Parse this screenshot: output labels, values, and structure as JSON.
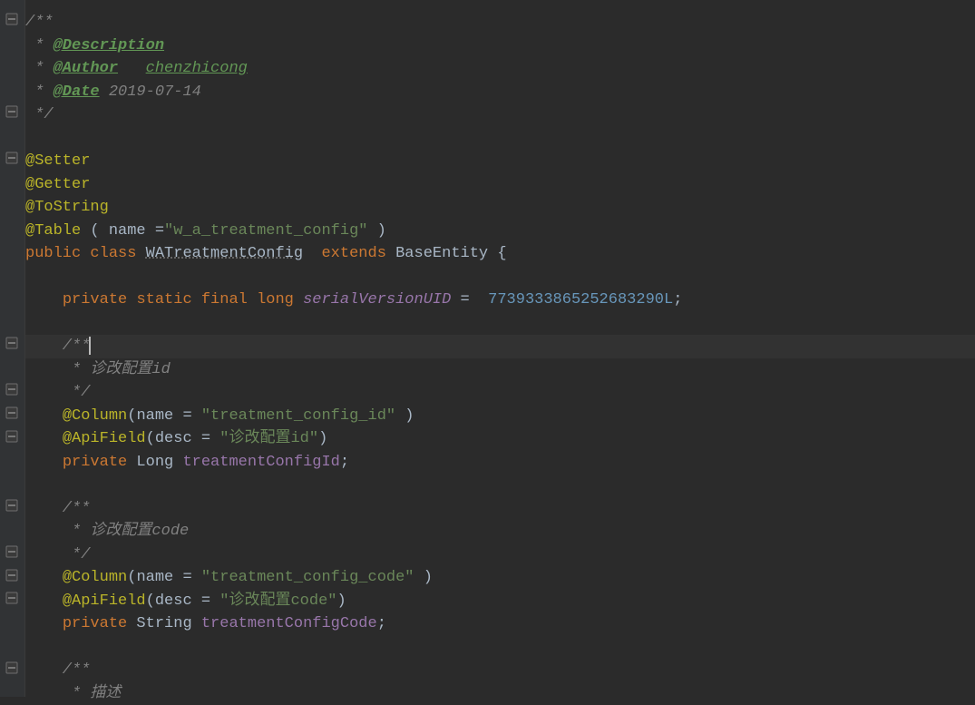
{
  "lines": {
    "l1": "/**",
    "l2a": " * ",
    "l2b": "@Description",
    "l3a": " * ",
    "l3b": "@Author",
    "l3c": "   ",
    "l3d": "chenzhicong",
    "l4a": " * ",
    "l4b": "@Date",
    "l4c": " 2019-07-14",
    "l5": " */",
    "l7": "@Setter",
    "l8": "@Getter",
    "l9": "@ToString",
    "l10a": "@Table",
    "l10b": " ( ",
    "l10c": "name",
    "l10d": " =",
    "l10e": "\"w_a_treatment_config\"",
    "l10f": " )",
    "l11a": "public",
    "l11b": " ",
    "l11c": "class",
    "l11d": " ",
    "l11e": "WATreatmentConfig",
    "l11f": "  ",
    "l11g": "extends",
    "l11h": " BaseEntity {",
    "l13a": "    ",
    "l13b": "private",
    "l13c": " ",
    "l13d": "static",
    "l13e": " ",
    "l13f": "final",
    "l13g": " ",
    "l13h": "long",
    "l13i": " ",
    "l13j": "serialVersionUID",
    "l13k": " =  ",
    "l13l": "7739333865252683290L",
    "l13m": ";",
    "l15": "    /**",
    "l16": "     * 诊改配置id",
    "l17": "     */",
    "l18a": "    ",
    "l18b": "@Column",
    "l18c": "(",
    "l18d": "name",
    "l18e": " = ",
    "l18f": "\"treatment_config_id\"",
    "l18g": " )",
    "l19a": "    ",
    "l19b": "@ApiField",
    "l19c": "(",
    "l19d": "desc",
    "l19e": " = ",
    "l19f": "\"诊改配置id\"",
    "l19g": ")",
    "l20a": "    ",
    "l20b": "private",
    "l20c": " Long ",
    "l20d": "treatmentConfigId",
    "l20e": ";",
    "l22": "    /**",
    "l23": "     * 诊改配置code",
    "l24": "     */",
    "l25a": "    ",
    "l25b": "@Column",
    "l25c": "(",
    "l25d": "name",
    "l25e": " = ",
    "l25f": "\"treatment_config_code\"",
    "l25g": " )",
    "l26a": "    ",
    "l26b": "@ApiField",
    "l26c": "(",
    "l26d": "desc",
    "l26e": " = ",
    "l26f": "\"诊改配置code\"",
    "l26g": ")",
    "l27a": "    ",
    "l27b": "private",
    "l27c": " String ",
    "l27d": "treatmentConfigCode",
    "l27e": ";",
    "l29": "    /**",
    "l30": "     * 描述"
  }
}
